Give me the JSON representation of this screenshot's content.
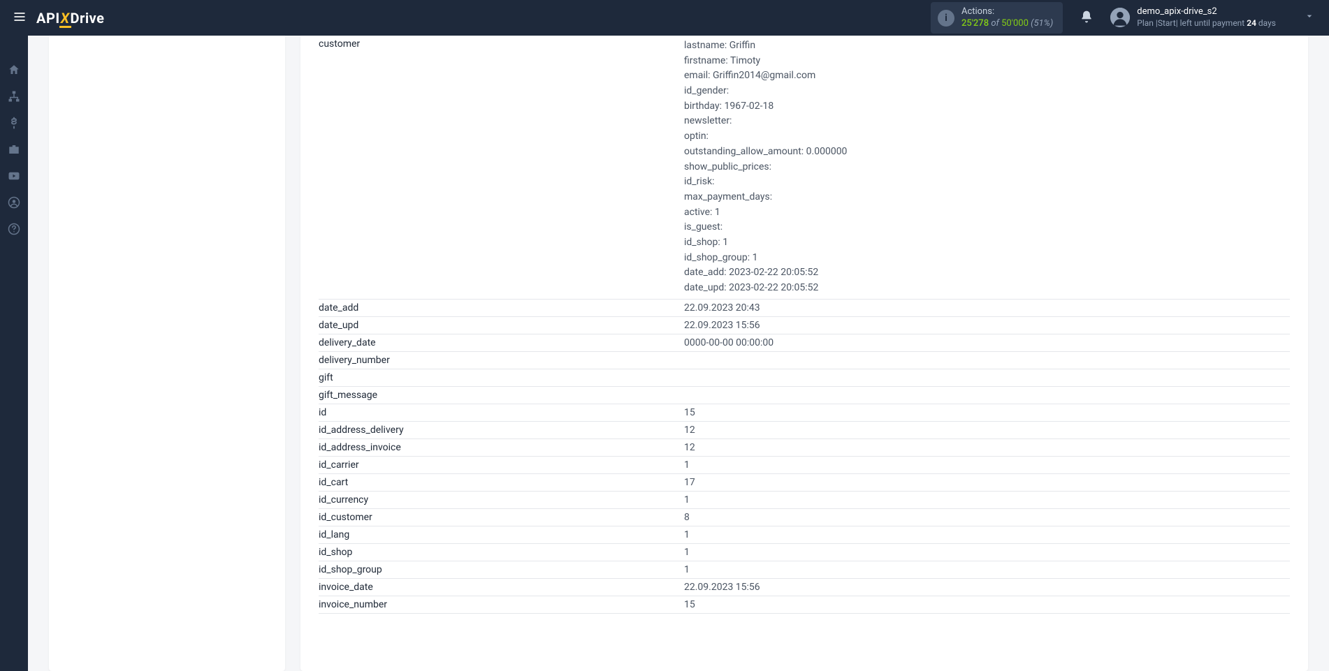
{
  "header": {
    "logo": {
      "api": "API",
      "x": "X",
      "drive": "Drive"
    },
    "actions": {
      "label": "Actions:",
      "count": "25'278",
      "of": "of",
      "total": "50'000",
      "pct": "(51%)"
    },
    "user": {
      "name": "demo_apix-drive_s2",
      "plan_prefix": "Plan |Start|  left until payment ",
      "days": "24",
      "days_suffix": " days"
    }
  },
  "customer_block": "lastname: Griffin\nfirstname: Timoty\nemail: Griffin2014@gmail.com\nid_gender:\nbirthday: 1967-02-18\nnewsletter:\noptin:\noutstanding_allow_amount: 0.000000\nshow_public_prices:\nid_risk:\nmax_payment_days:\nactive: 1\nis_guest:\nid_shop: 1\nid_shop_group: 1\ndate_add: 2023-02-22 20:05:52\ndate_upd: 2023-02-22 20:05:52",
  "rows": [
    {
      "key": "customer",
      "value_is_customer": true
    },
    {
      "key": "date_add",
      "value": "22.09.2023 20:43"
    },
    {
      "key": "date_upd",
      "value": "22.09.2023 15:56"
    },
    {
      "key": "delivery_date",
      "value": "0000-00-00 00:00:00"
    },
    {
      "key": "delivery_number",
      "value": ""
    },
    {
      "key": "gift",
      "value": ""
    },
    {
      "key": "gift_message",
      "value": ""
    },
    {
      "key": "id",
      "value": "15"
    },
    {
      "key": "id_address_delivery",
      "value": "12"
    },
    {
      "key": "id_address_invoice",
      "value": "12"
    },
    {
      "key": "id_carrier",
      "value": "1"
    },
    {
      "key": "id_cart",
      "value": "17"
    },
    {
      "key": "id_currency",
      "value": "1"
    },
    {
      "key": "id_customer",
      "value": "8"
    },
    {
      "key": "id_lang",
      "value": "1"
    },
    {
      "key": "id_shop",
      "value": "1"
    },
    {
      "key": "id_shop_group",
      "value": "1"
    },
    {
      "key": "invoice_date",
      "value": "22.09.2023 15:56"
    },
    {
      "key": "invoice_number",
      "value": "15"
    }
  ]
}
